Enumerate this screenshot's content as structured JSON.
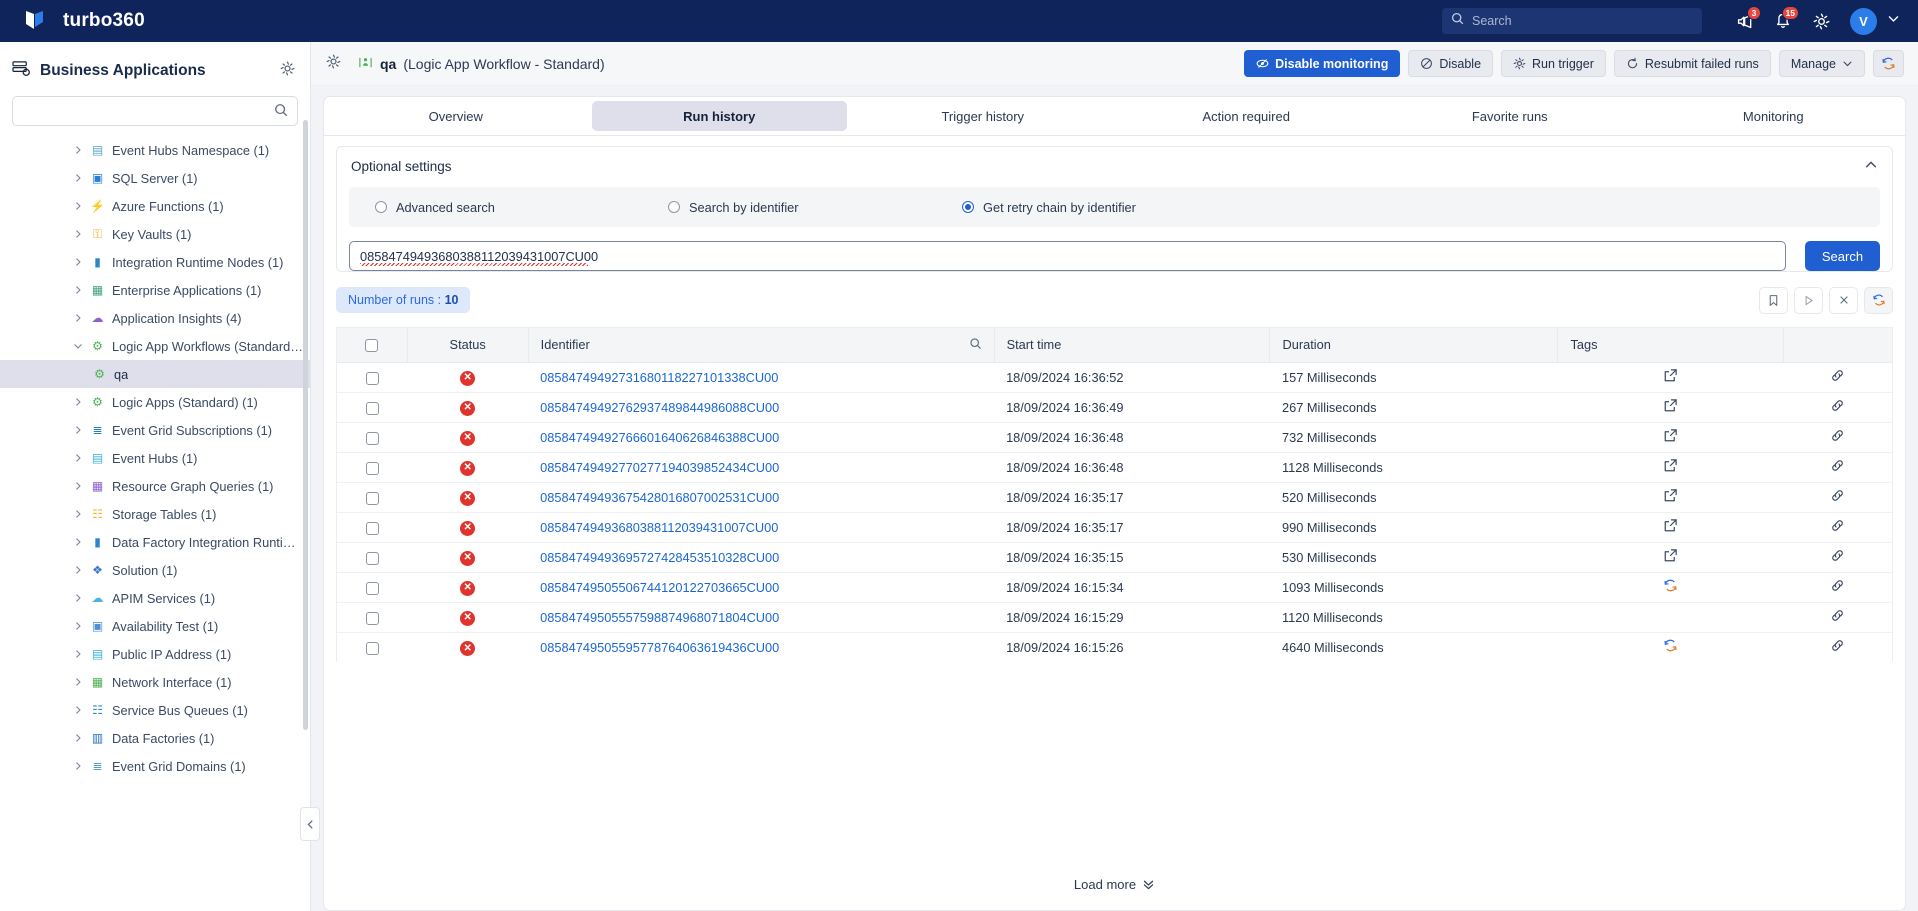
{
  "topbar": {
    "brand": "turbo360",
    "search_placeholder": "Search",
    "announcements_badge": "3",
    "notifications_badge": "15",
    "avatar_initial": "V"
  },
  "sidebar": {
    "title": "Business Applications",
    "search_placeholder": "",
    "search_value": "",
    "items": [
      {
        "label": "Event Hubs Namespace (1)",
        "icon": "event-hubs-namespace-icon",
        "glyph": "▤",
        "color": "#5aa6c9",
        "expanded": false,
        "selected": false
      },
      {
        "label": "SQL Server (1)",
        "icon": "sql-server-icon",
        "glyph": "▣",
        "color": "#2b7cd3",
        "expanded": false,
        "selected": false
      },
      {
        "label": "Azure Functions (1)",
        "icon": "azure-functions-icon",
        "glyph": "⚡",
        "color": "#f2c94c",
        "expanded": false,
        "selected": false
      },
      {
        "label": "Key Vaults (1)",
        "icon": "key-vault-icon",
        "glyph": "⚿",
        "color": "#f2b134",
        "expanded": false,
        "selected": false
      },
      {
        "label": "Integration Runtime Nodes (1)",
        "icon": "integration-runtime-icon",
        "glyph": "▮",
        "color": "#2f86c7",
        "expanded": false,
        "selected": false
      },
      {
        "label": "Enterprise Applications (1)",
        "icon": "enterprise-apps-icon",
        "glyph": "▦",
        "color": "#3fa37d",
        "expanded": false,
        "selected": false
      },
      {
        "label": "Application Insights (4)",
        "icon": "app-insights-icon",
        "glyph": "☁",
        "color": "#8d5fd3",
        "expanded": false,
        "selected": false
      },
      {
        "label": "Logic App Workflows (Standard…",
        "icon": "logic-app-workflow-icon",
        "glyph": "⚙",
        "color": "#4caf50",
        "expanded": true,
        "selected": false
      },
      {
        "label": "qa",
        "icon": "logic-app-workflow-icon",
        "glyph": "⚙",
        "color": "#4caf50",
        "child": true,
        "selected": true
      },
      {
        "label": "Logic Apps (Standard) (1)",
        "icon": "logic-apps-icon",
        "glyph": "⚙",
        "color": "#4caf50",
        "expanded": false,
        "selected": false
      },
      {
        "label": "Event Grid Subscriptions (1)",
        "icon": "event-grid-subscription-icon",
        "glyph": "≣",
        "color": "#1b7fc4",
        "expanded": false,
        "selected": false
      },
      {
        "label": "Event Hubs (1)",
        "icon": "event-hubs-icon",
        "glyph": "▤",
        "color": "#41b0d4",
        "expanded": false,
        "selected": false
      },
      {
        "label": "Resource Graph Queries (1)",
        "icon": "resource-graph-queries-icon",
        "glyph": "▦",
        "color": "#8d5fd3",
        "expanded": false,
        "selected": false
      },
      {
        "label": "Storage Tables (1)",
        "icon": "storage-tables-icon",
        "glyph": "☷",
        "color": "#f0b429",
        "expanded": false,
        "selected": false
      },
      {
        "label": "Data Factory Integration Runti…",
        "icon": "data-factory-runtime-icon",
        "glyph": "▮",
        "color": "#2f86c7",
        "expanded": false,
        "selected": false
      },
      {
        "label": "Solution (1)",
        "icon": "solution-icon",
        "glyph": "❖",
        "color": "#3a78c9",
        "expanded": false,
        "selected": false
      },
      {
        "label": "APIM Services (1)",
        "icon": "apim-services-icon",
        "glyph": "☁",
        "color": "#49b4e0",
        "expanded": false,
        "selected": false
      },
      {
        "label": "Availability Test (1)",
        "icon": "availability-test-icon",
        "glyph": "▣",
        "color": "#4f8fd6",
        "expanded": false,
        "selected": false
      },
      {
        "label": "Public IP Address (1)",
        "icon": "public-ip-address-icon",
        "glyph": "▤",
        "color": "#36b0d9",
        "expanded": false,
        "selected": false
      },
      {
        "label": "Network Interface (1)",
        "icon": "network-interface-icon",
        "glyph": "▦",
        "color": "#4caf50",
        "expanded": false,
        "selected": false
      },
      {
        "label": "Service Bus Queues (1)",
        "icon": "service-bus-queues-icon",
        "glyph": "☷",
        "color": "#2f86c7",
        "expanded": false,
        "selected": false
      },
      {
        "label": "Data Factories (1)",
        "icon": "data-factories-icon",
        "glyph": "▥",
        "color": "#1f6fc0",
        "expanded": false,
        "selected": false
      },
      {
        "label": "Event Grid Domains (1)",
        "icon": "event-grid-domains-icon",
        "glyph": "≣",
        "color": "#4aa3c9",
        "expanded": false,
        "selected": false
      }
    ]
  },
  "main": {
    "resource_name": "qa",
    "resource_type": "(Logic App Workflow - Standard)",
    "actions": {
      "disable_monitoring": "Disable monitoring",
      "disable": "Disable",
      "run_trigger": "Run trigger",
      "resubmit_failed_runs": "Resubmit failed runs",
      "manage": "Manage"
    },
    "tabs": [
      {
        "label": "Overview",
        "active": false
      },
      {
        "label": "Run history",
        "active": true
      },
      {
        "label": "Trigger history",
        "active": false
      },
      {
        "label": "Action required",
        "active": false
      },
      {
        "label": "Favorite runs",
        "active": false
      },
      {
        "label": "Monitoring",
        "active": false
      }
    ],
    "optional_settings": {
      "title": "Optional settings",
      "radios": [
        {
          "label": "Advanced search",
          "selected": false
        },
        {
          "label": "Search by identifier",
          "selected": false
        },
        {
          "label": "Get retry chain by identifier",
          "selected": true
        }
      ],
      "identifier_value": "08584749493680388112039431007CU00",
      "identifier_placeholder": "",
      "search_button": "Search"
    },
    "runs_badge_label": "Number of runs  :",
    "runs_badge_count": "10",
    "table": {
      "columns": [
        "Status",
        "Identifier",
        "Start time",
        "Duration",
        "Tags"
      ],
      "rows": [
        {
          "status": "failed",
          "identifier": "08584749492731680118227101338CU00",
          "start": "18/09/2024 16:36:52",
          "duration": "157 Milliseconds",
          "tag_icon": "open-external-icon",
          "link_icon": "link-icon"
        },
        {
          "status": "failed",
          "identifier": "08584749492762937489844986088CU00",
          "start": "18/09/2024 16:36:49",
          "duration": "267 Milliseconds",
          "tag_icon": "open-external-icon",
          "link_icon": "link-icon"
        },
        {
          "status": "failed",
          "identifier": "08584749492766601640626846388CU00",
          "start": "18/09/2024 16:36:48",
          "duration": "732 Milliseconds",
          "tag_icon": "open-external-icon",
          "link_icon": "link-icon"
        },
        {
          "status": "failed",
          "identifier": "08584749492770277194039852434CU00",
          "start": "18/09/2024 16:36:48",
          "duration": "1128 Milliseconds",
          "tag_icon": "open-external-icon",
          "link_icon": "link-icon"
        },
        {
          "status": "failed",
          "identifier": "08584749493675428016807002531CU00",
          "start": "18/09/2024 16:35:17",
          "duration": "520 Milliseconds",
          "tag_icon": "open-external-icon",
          "link_icon": "link-icon"
        },
        {
          "status": "failed",
          "identifier": "08584749493680388112039431007CU00",
          "start": "18/09/2024 16:35:17",
          "duration": "990 Milliseconds",
          "tag_icon": "open-external-icon",
          "link_icon": "link-icon"
        },
        {
          "status": "failed",
          "identifier": "08584749493695727428453510328CU00",
          "start": "18/09/2024 16:35:15",
          "duration": "530 Milliseconds",
          "tag_icon": "open-external-icon",
          "link_icon": "link-icon"
        },
        {
          "status": "failed",
          "identifier": "08584749505506744120122703665CU00",
          "start": "18/09/2024 16:15:34",
          "duration": "1093 Milliseconds",
          "tag_icon": "resubmit-icon",
          "link_icon": "link-icon"
        },
        {
          "status": "failed",
          "identifier": "08584749505557598874968071804CU00",
          "start": "18/09/2024 16:15:29",
          "duration": "1120 Milliseconds",
          "tag_icon": "",
          "link_icon": "link-icon"
        },
        {
          "status": "failed",
          "identifier": "08584749505595778764063619436CU00",
          "start": "18/09/2024 16:15:26",
          "duration": "4640 Milliseconds",
          "tag_icon": "resubmit-icon",
          "link_icon": "link-icon"
        }
      ]
    },
    "load_more": "Load more"
  },
  "colors": {
    "brand_navy": "#10245c",
    "accent_blue": "#1f5fd1",
    "link_blue": "#1b67d4",
    "error_red": "#e0332c",
    "badge_red": "#e8453c"
  }
}
